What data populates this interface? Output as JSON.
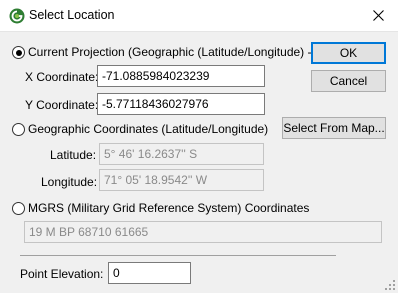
{
  "window": {
    "title": "Select Location",
    "app_icon": "globe-app-icon",
    "close_icon": "close-icon"
  },
  "current_projection": {
    "label": "Current Projection (Geographic (Latitude/Longitude) - arc",
    "selected": true,
    "x_label": "X Coordinate:",
    "x_value": "-71.0885984023239",
    "y_label": "Y Coordinate:",
    "y_value": "-5.77118436027976"
  },
  "geographic": {
    "label": "Geographic Coordinates (Latitude/Longitude)",
    "selected": false,
    "latitude_label": "Latitude:",
    "latitude_value": "5° 46' 16.2637'' S",
    "longitude_label": "Longitude:",
    "longitude_value": "71° 05' 18.9542'' W"
  },
  "mgrs": {
    "label": "MGRS (Military Grid Reference System) Coordinates",
    "selected": false,
    "value": "19 M BP 68710 61665"
  },
  "point_elevation": {
    "label": "Point Elevation:",
    "value": "0"
  },
  "buttons": {
    "ok": "OK",
    "cancel": "Cancel",
    "select_from_map": "Select From Map..."
  },
  "colors": {
    "accent": "#0078d7",
    "dialog_bg": "#f0f0f0"
  }
}
